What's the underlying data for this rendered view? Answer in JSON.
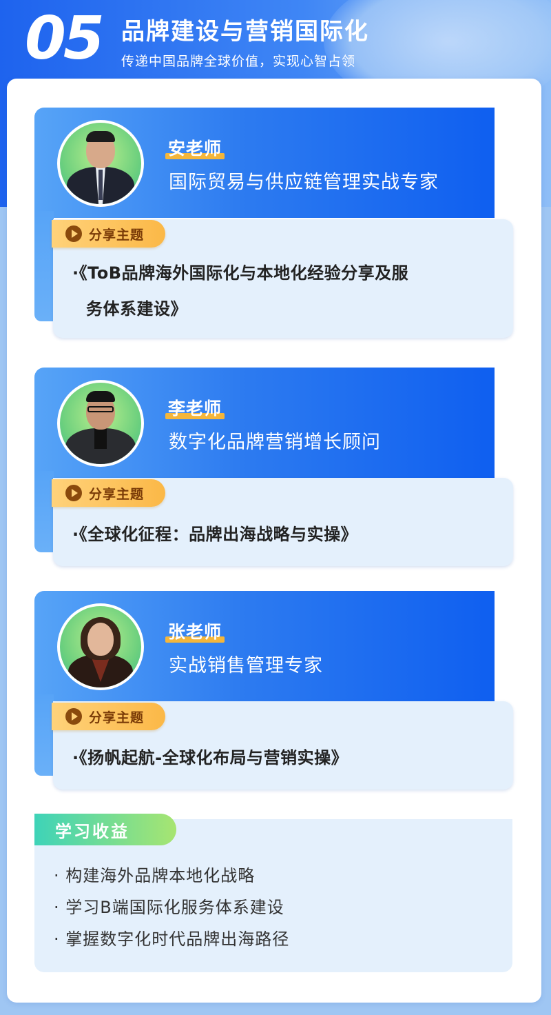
{
  "header": {
    "number": "05",
    "title": "品牌建设与营销国际化",
    "subtitle": "传递中国品牌全球价值，实现心智占领"
  },
  "topic_label": "分享主题",
  "teachers": [
    {
      "name": "安老师",
      "role": "国际贸易与供应链管理实战专家",
      "topic_lines": [
        "·《ToB品牌海外国际化与本地化经验分享及服",
        "务体系建设》"
      ],
      "photo": "man-in-suit-portrait"
    },
    {
      "name": "李老师",
      "role": "数字化品牌营销增长顾问",
      "topic_lines": [
        "·《全球化征程：品牌出海战略与实操》"
      ],
      "photo": "man-with-glasses-portrait"
    },
    {
      "name": "张老师",
      "role": "实战销售管理专家",
      "topic_lines": [
        "·《扬帆起航-全球化布局与营销实操》"
      ],
      "photo": "woman-portrait"
    }
  ],
  "gains": {
    "title": "学习收益",
    "items": [
      "· 构建海外品牌本地化战略",
      "· 学习B端国际化服务体系建设",
      "· 掌握数字化时代品牌出海路径"
    ]
  },
  "colors": {
    "blue": "#0f5ff0",
    "orange": "#fbb847",
    "green": "#3ed3b8"
  }
}
